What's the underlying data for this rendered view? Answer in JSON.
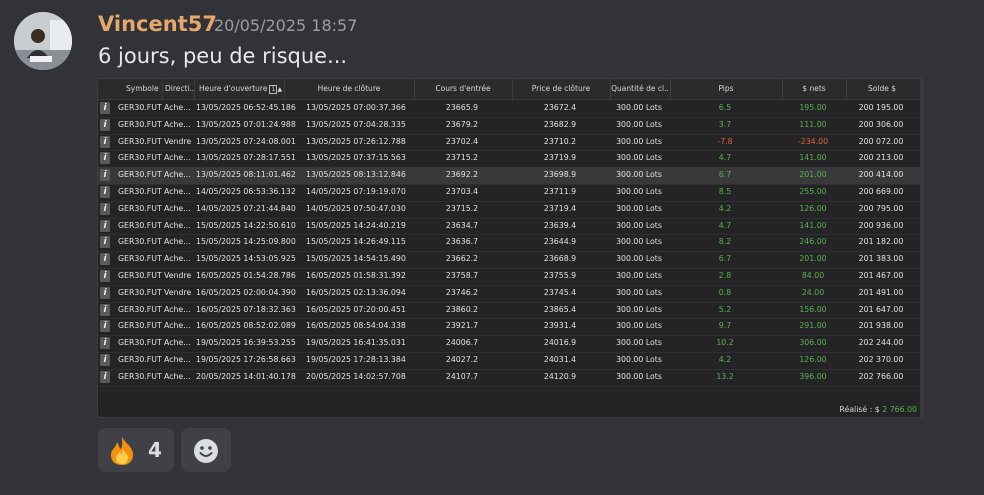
{
  "author": "Vincent57",
  "timestamp": "20/05/2025 18:57",
  "message": "6 jours, peu de risque...",
  "table": {
    "headers": [
      "Symbole",
      "Directi..",
      "Heure d'ouverture",
      "Heure de clôture",
      "Cours d'entrée",
      "Price de clôture",
      "Quantité de cl..",
      "Pips",
      "$ nets",
      "Solde $"
    ],
    "sort_indicator": "1",
    "rows": [
      [
        "GER30.FUT",
        "Ache...",
        "13/05/2025 06:52:45.186",
        "13/05/2025 07:00:37.366",
        "23665.9",
        "23672.4",
        "300.00 Lots",
        "6.5",
        "195.00",
        "200 195.00"
      ],
      [
        "GER30.FUT",
        "Ache...",
        "13/05/2025 07:01:24.988",
        "13/05/2025 07:04:28.335",
        "23679.2",
        "23682.9",
        "300.00 Lots",
        "3.7",
        "111.00",
        "200 306.00"
      ],
      [
        "GER30.FUT",
        "Vendre",
        "13/05/2025 07:24:08.001",
        "13/05/2025 07:26:12.788",
        "23702.4",
        "23710.2",
        "300.00 Lots",
        "-7.8",
        "-234.00",
        "200 072.00"
      ],
      [
        "GER30.FUT",
        "Ache...",
        "13/05/2025 07:28:17.551",
        "13/05/2025 07:37:15.563",
        "23715.2",
        "23719.9",
        "300.00 Lots",
        "4.7",
        "141.00",
        "200 213.00"
      ],
      [
        "GER30.FUT",
        "Ache...",
        "13/05/2025 08:11:01.462",
        "13/05/2025 08:13:12.846",
        "23692.2",
        "23698.9",
        "300.00 Lots",
        "6.7",
        "201.00",
        "200 414.00"
      ],
      [
        "GER30.FUT",
        "Ache...",
        "14/05/2025 06:53:36.132",
        "14/05/2025 07:19:19.070",
        "23703.4",
        "23711.9",
        "300.00 Lots",
        "8.5",
        "255.00",
        "200 669.00"
      ],
      [
        "GER30.FUT",
        "Ache...",
        "14/05/2025 07:21:44.840",
        "14/05/2025 07:50:47.030",
        "23715.2",
        "23719.4",
        "300.00 Lots",
        "4.2",
        "126.00",
        "200 795.00"
      ],
      [
        "GER30.FUT",
        "Ache...",
        "15/05/2025 14:22:50.610",
        "15/05/2025 14:24:40.219",
        "23634.7",
        "23639.4",
        "300.00 Lots",
        "4.7",
        "141.00",
        "200 936.00"
      ],
      [
        "GER30.FUT",
        "Ache...",
        "15/05/2025 14:25:09.800",
        "15/05/2025 14:26:49.115",
        "23636.7",
        "23644.9",
        "300.00 Lots",
        "8.2",
        "246.00",
        "201 182.00"
      ],
      [
        "GER30.FUT",
        "Ache...",
        "15/05/2025 14:53:05.925",
        "15/05/2025 14:54:15.490",
        "23662.2",
        "23668.9",
        "300.00 Lots",
        "6.7",
        "201.00",
        "201 383.00"
      ],
      [
        "GER30.FUT",
        "Vendre",
        "16/05/2025 01:54:28.786",
        "16/05/2025 01:58:31.392",
        "23758.7",
        "23755.9",
        "300.00 Lots",
        "2.8",
        "84.00",
        "201 467.00"
      ],
      [
        "GER30.FUT",
        "Vendre",
        "16/05/2025 02:00:04.390",
        "16/05/2025 02:13:36.094",
        "23746.2",
        "23745.4",
        "300.00 Lots",
        "0.8",
        "24.00",
        "201 491.00"
      ],
      [
        "GER30.FUT",
        "Ache...",
        "16/05/2025 07:18:32.363",
        "16/05/2025 07:20:00.451",
        "23860.2",
        "23865.4",
        "300.00 Lots",
        "5.2",
        "156.00",
        "201 647.00"
      ],
      [
        "GER30.FUT",
        "Ache...",
        "16/05/2025 08:52:02.089",
        "16/05/2025 08:54:04.338",
        "23921.7",
        "23931.4",
        "300.00 Lots",
        "9.7",
        "291.00",
        "201 938.00"
      ],
      [
        "GER30.FUT",
        "Ache...",
        "19/05/2025 16:39:53.255",
        "19/05/2025 16:41:35.031",
        "24006.7",
        "24016.9",
        "300.00 Lots",
        "10.2",
        "306.00",
        "202 244.00"
      ],
      [
        "GER30.FUT",
        "Ache...",
        "19/05/2025 17:26:58.663",
        "19/05/2025 17:28:13.384",
        "24027.2",
        "24031.4",
        "300.00 Lots",
        "4.2",
        "126.00",
        "202 370.00"
      ],
      [
        "GER30.FUT",
        "Ache...",
        "20/05/2025 14:01:40.178",
        "20/05/2025 14:02:57.708",
        "24107.7",
        "24120.9",
        "300.00 Lots",
        "13.2",
        "396.00",
        "202 766.00"
      ]
    ],
    "highlighted_row": 4,
    "footer_label": "Réalisé :  $",
    "footer_value": "2 766.00"
  },
  "reactions": [
    {
      "icon": "fire-emoji-icon",
      "count": "4"
    },
    {
      "icon": "add-reaction-smiley-icon"
    }
  ],
  "colors": {
    "positive": "#58b24a",
    "negative": "#e0622d",
    "author": "#e5a86a"
  }
}
